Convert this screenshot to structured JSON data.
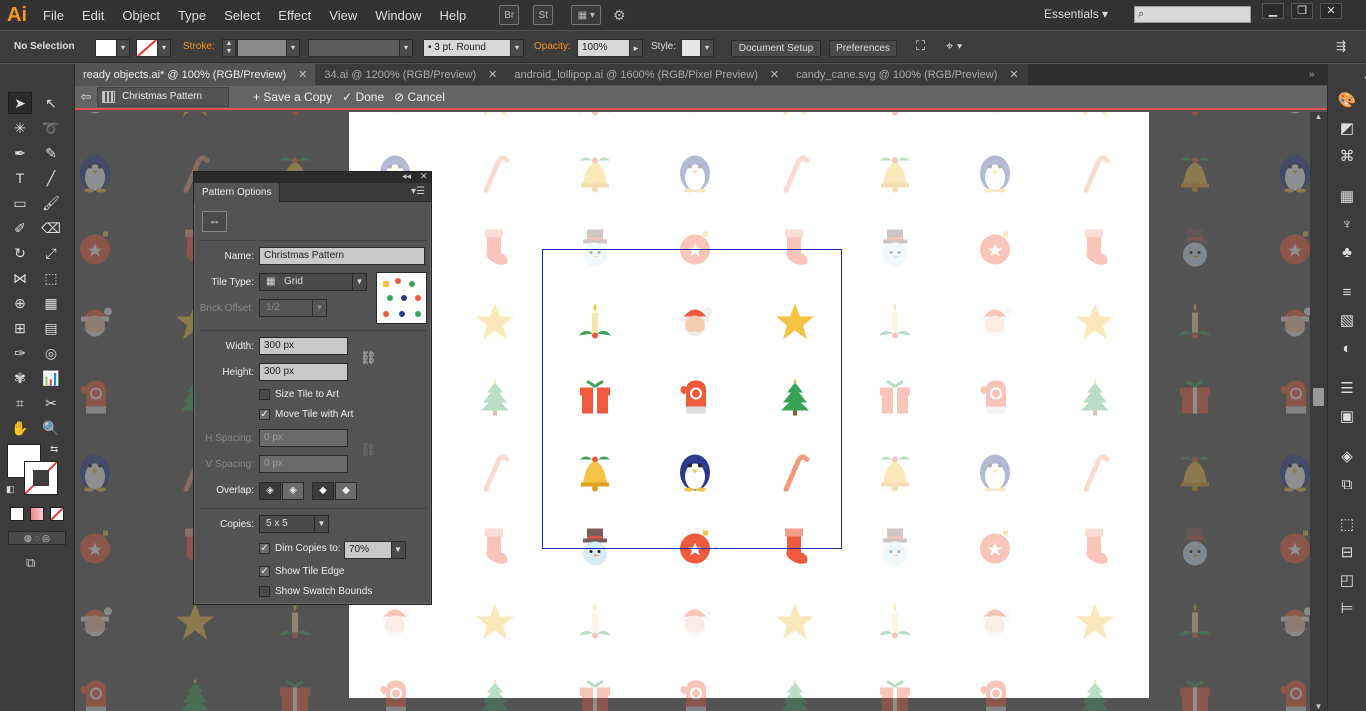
{
  "app": {
    "logo": "Ai"
  },
  "menu": [
    "File",
    "Edit",
    "Object",
    "Type",
    "Select",
    "Effect",
    "View",
    "Window",
    "Help"
  ],
  "menubar_icons": {
    "br": "Br",
    "st": "St"
  },
  "workspace": {
    "label": "Essentials"
  },
  "control_bar": {
    "selection": "No Selection",
    "stroke_label": "Stroke:",
    "brush": "3 pt. Round",
    "opacity_label": "Opacity:",
    "opacity_value": "100%",
    "style_label": "Style:",
    "document_setup": "Document Setup",
    "preferences": "Preferences"
  },
  "tabs": [
    {
      "label": "ready objects.ai* @ 100% (RGB/Preview)",
      "active": true
    },
    {
      "label": "34.ai @ 1200% (RGB/Preview)",
      "active": false
    },
    {
      "label": "android_lollipop.ai @ 1600% (RGB/Pixel Preview)",
      "active": false
    },
    {
      "label": "candy_cane.svg @ 100% (RGB/Preview)",
      "active": false
    }
  ],
  "pattern_bar": {
    "name": "Christmas Pattern",
    "save_copy": "Save a Copy",
    "done": "Done",
    "cancel": "Cancel"
  },
  "pattern_options": {
    "title": "Pattern Options",
    "name_label": "Name:",
    "name_value": "Christmas Pattern",
    "tile_type_label": "Tile Type:",
    "tile_type_value": "Grid",
    "brick_offset_label": "Brick Offset:",
    "brick_offset_value": "1/2",
    "width_label": "Width:",
    "width_value": "300 px",
    "height_label": "Height:",
    "height_value": "300 px",
    "size_tile_to_art": "Size Tile to Art",
    "move_tile_with_art": "Move Tile with Art",
    "h_spacing_label": "H Spacing:",
    "h_spacing_value": "0 px",
    "v_spacing_label": "V Spacing:",
    "v_spacing_value": "0 px",
    "overlap_label": "Overlap:",
    "copies_label": "Copies:",
    "copies_value": "5 x 5",
    "dim_copies_label": "Dim Copies to:",
    "dim_copies_value": "70%",
    "show_tile_edge": "Show Tile Edge",
    "show_swatch_bounds": "Show Swatch Bounds",
    "checked": {
      "size_tile_to_art": false,
      "move_tile_with_art": true,
      "dim_copies": true,
      "show_tile_edge": true,
      "show_swatch_bounds": false
    }
  },
  "colors": {
    "orange_label": "#f7941d",
    "tile_edge": "#1b2aa8",
    "pattern_bar_line": "#e05050",
    "motif_red": "#f05a3c",
    "motif_gold": "#f5c242",
    "motif_green": "#3aa35a",
    "motif_navy": "#2b3a8c"
  }
}
